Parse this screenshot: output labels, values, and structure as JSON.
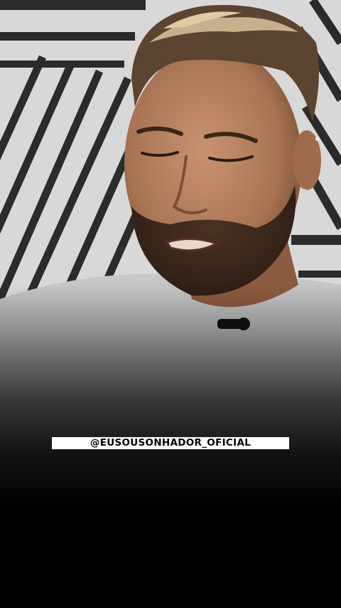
{
  "video": {
    "description_icon": "video-frame",
    "watermark_text": "@EUSOUSONHADOR_OFICIAL"
  },
  "colors": {
    "background": "#000000",
    "wall": "#dcdcdc",
    "stripe": "#2a2a2a",
    "shirt": "#a9a9a9",
    "skin": "#b98463",
    "watermark_bg": "#ffffff",
    "watermark_text": "#000000"
  }
}
